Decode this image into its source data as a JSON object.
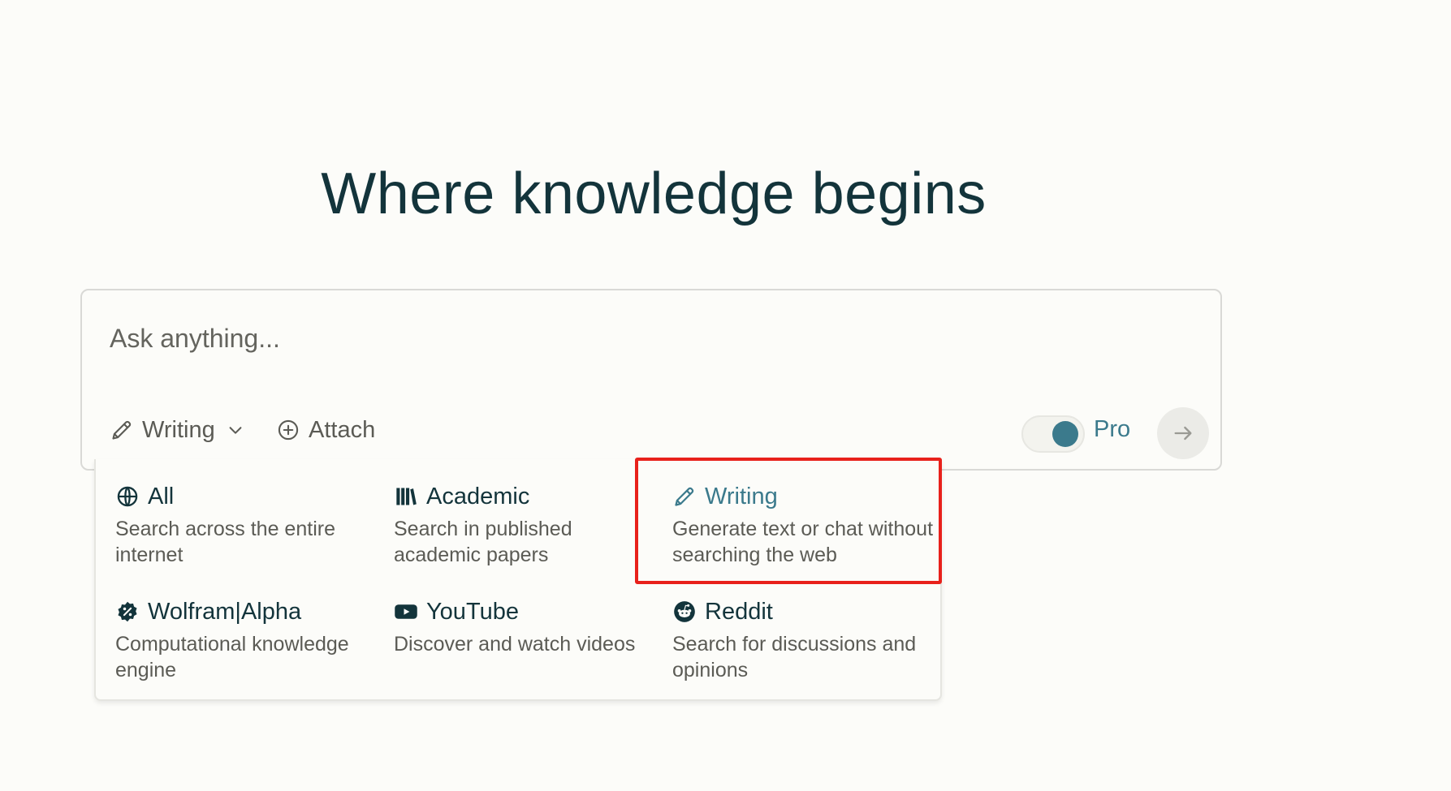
{
  "headline": "Where knowledge begins",
  "search": {
    "placeholder": "Ask anything..."
  },
  "toolbar": {
    "focus_label": "Writing",
    "attach_label": "Attach",
    "pro_label": "Pro",
    "pro_enabled": true
  },
  "focus_menu": {
    "selected": "Writing",
    "items": [
      {
        "title": "All",
        "description": "Search across the entire internet",
        "icon": "globe-icon"
      },
      {
        "title": "Academic",
        "description": "Search in published academic papers",
        "icon": "library-icon"
      },
      {
        "title": "Writing",
        "description": "Generate text or chat without searching the web",
        "icon": "pencil-icon"
      },
      {
        "title": "Wolfram|Alpha",
        "description": "Computational knowledge engine",
        "icon": "wolfram-icon"
      },
      {
        "title": "YouTube",
        "description": "Discover and watch videos",
        "icon": "youtube-icon"
      },
      {
        "title": "Reddit",
        "description": "Search for discussions and opinions",
        "icon": "reddit-icon"
      }
    ]
  },
  "colors": {
    "accent": "#3b7a8c",
    "text": "#13343b",
    "muted": "#5b5b55",
    "background": "#fcfcf9",
    "highlight": "#e8211b"
  }
}
